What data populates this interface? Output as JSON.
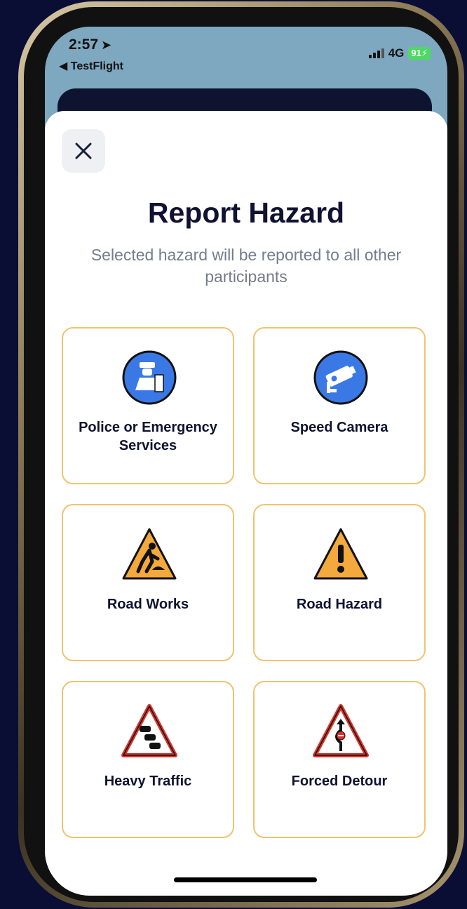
{
  "status_bar": {
    "time": "2:57",
    "back_app": "◀ TestFlight",
    "network": "4G",
    "battery": "91"
  },
  "sheet": {
    "title": "Report Hazard",
    "subtitle": "Selected hazard will be reported to all other participants"
  },
  "hazards": [
    {
      "label": "Police or Emergency Services",
      "icon": "police-icon"
    },
    {
      "label": "Speed Camera",
      "icon": "speed-camera-icon"
    },
    {
      "label": "Road Works",
      "icon": "road-works-icon"
    },
    {
      "label": "Road Hazard",
      "icon": "road-hazard-icon"
    },
    {
      "label": "Heavy Traffic",
      "icon": "heavy-traffic-icon"
    },
    {
      "label": "Forced Detour",
      "icon": "forced-detour-icon"
    }
  ],
  "colors": {
    "accent_border": "#f0c370",
    "icon_blue": "#3a78e6",
    "warning_yellow": "#f3a93b",
    "warning_red": "#d9322b",
    "title": "#0f1230"
  }
}
